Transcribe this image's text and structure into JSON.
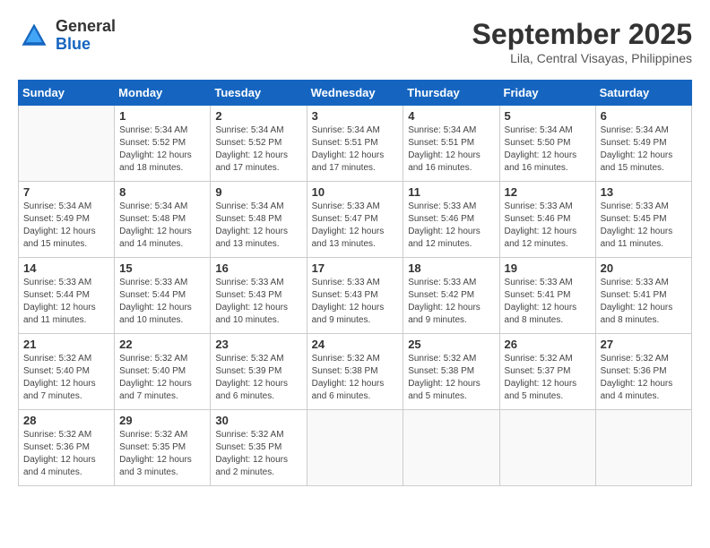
{
  "header": {
    "logo": {
      "general": "General",
      "blue": "Blue"
    },
    "title": "September 2025",
    "subtitle": "Lila, Central Visayas, Philippines"
  },
  "weekdays": [
    "Sunday",
    "Monday",
    "Tuesday",
    "Wednesday",
    "Thursday",
    "Friday",
    "Saturday"
  ],
  "weeks": [
    [
      {
        "day": "",
        "info": ""
      },
      {
        "day": "1",
        "info": "Sunrise: 5:34 AM\nSunset: 5:52 PM\nDaylight: 12 hours\nand 18 minutes."
      },
      {
        "day": "2",
        "info": "Sunrise: 5:34 AM\nSunset: 5:52 PM\nDaylight: 12 hours\nand 17 minutes."
      },
      {
        "day": "3",
        "info": "Sunrise: 5:34 AM\nSunset: 5:51 PM\nDaylight: 12 hours\nand 17 minutes."
      },
      {
        "day": "4",
        "info": "Sunrise: 5:34 AM\nSunset: 5:51 PM\nDaylight: 12 hours\nand 16 minutes."
      },
      {
        "day": "5",
        "info": "Sunrise: 5:34 AM\nSunset: 5:50 PM\nDaylight: 12 hours\nand 16 minutes."
      },
      {
        "day": "6",
        "info": "Sunrise: 5:34 AM\nSunset: 5:49 PM\nDaylight: 12 hours\nand 15 minutes."
      }
    ],
    [
      {
        "day": "7",
        "info": "Sunrise: 5:34 AM\nSunset: 5:49 PM\nDaylight: 12 hours\nand 15 minutes."
      },
      {
        "day": "8",
        "info": "Sunrise: 5:34 AM\nSunset: 5:48 PM\nDaylight: 12 hours\nand 14 minutes."
      },
      {
        "day": "9",
        "info": "Sunrise: 5:34 AM\nSunset: 5:48 PM\nDaylight: 12 hours\nand 13 minutes."
      },
      {
        "day": "10",
        "info": "Sunrise: 5:33 AM\nSunset: 5:47 PM\nDaylight: 12 hours\nand 13 minutes."
      },
      {
        "day": "11",
        "info": "Sunrise: 5:33 AM\nSunset: 5:46 PM\nDaylight: 12 hours\nand 12 minutes."
      },
      {
        "day": "12",
        "info": "Sunrise: 5:33 AM\nSunset: 5:46 PM\nDaylight: 12 hours\nand 12 minutes."
      },
      {
        "day": "13",
        "info": "Sunrise: 5:33 AM\nSunset: 5:45 PM\nDaylight: 12 hours\nand 11 minutes."
      }
    ],
    [
      {
        "day": "14",
        "info": "Sunrise: 5:33 AM\nSunset: 5:44 PM\nDaylight: 12 hours\nand 11 minutes."
      },
      {
        "day": "15",
        "info": "Sunrise: 5:33 AM\nSunset: 5:44 PM\nDaylight: 12 hours\nand 10 minutes."
      },
      {
        "day": "16",
        "info": "Sunrise: 5:33 AM\nSunset: 5:43 PM\nDaylight: 12 hours\nand 10 minutes."
      },
      {
        "day": "17",
        "info": "Sunrise: 5:33 AM\nSunset: 5:43 PM\nDaylight: 12 hours\nand 9 minutes."
      },
      {
        "day": "18",
        "info": "Sunrise: 5:33 AM\nSunset: 5:42 PM\nDaylight: 12 hours\nand 9 minutes."
      },
      {
        "day": "19",
        "info": "Sunrise: 5:33 AM\nSunset: 5:41 PM\nDaylight: 12 hours\nand 8 minutes."
      },
      {
        "day": "20",
        "info": "Sunrise: 5:33 AM\nSunset: 5:41 PM\nDaylight: 12 hours\nand 8 minutes."
      }
    ],
    [
      {
        "day": "21",
        "info": "Sunrise: 5:32 AM\nSunset: 5:40 PM\nDaylight: 12 hours\nand 7 minutes."
      },
      {
        "day": "22",
        "info": "Sunrise: 5:32 AM\nSunset: 5:40 PM\nDaylight: 12 hours\nand 7 minutes."
      },
      {
        "day": "23",
        "info": "Sunrise: 5:32 AM\nSunset: 5:39 PM\nDaylight: 12 hours\nand 6 minutes."
      },
      {
        "day": "24",
        "info": "Sunrise: 5:32 AM\nSunset: 5:38 PM\nDaylight: 12 hours\nand 6 minutes."
      },
      {
        "day": "25",
        "info": "Sunrise: 5:32 AM\nSunset: 5:38 PM\nDaylight: 12 hours\nand 5 minutes."
      },
      {
        "day": "26",
        "info": "Sunrise: 5:32 AM\nSunset: 5:37 PM\nDaylight: 12 hours\nand 5 minutes."
      },
      {
        "day": "27",
        "info": "Sunrise: 5:32 AM\nSunset: 5:36 PM\nDaylight: 12 hours\nand 4 minutes."
      }
    ],
    [
      {
        "day": "28",
        "info": "Sunrise: 5:32 AM\nSunset: 5:36 PM\nDaylight: 12 hours\nand 4 minutes."
      },
      {
        "day": "29",
        "info": "Sunrise: 5:32 AM\nSunset: 5:35 PM\nDaylight: 12 hours\nand 3 minutes."
      },
      {
        "day": "30",
        "info": "Sunrise: 5:32 AM\nSunset: 5:35 PM\nDaylight: 12 hours\nand 2 minutes."
      },
      {
        "day": "",
        "info": ""
      },
      {
        "day": "",
        "info": ""
      },
      {
        "day": "",
        "info": ""
      },
      {
        "day": "",
        "info": ""
      }
    ]
  ]
}
